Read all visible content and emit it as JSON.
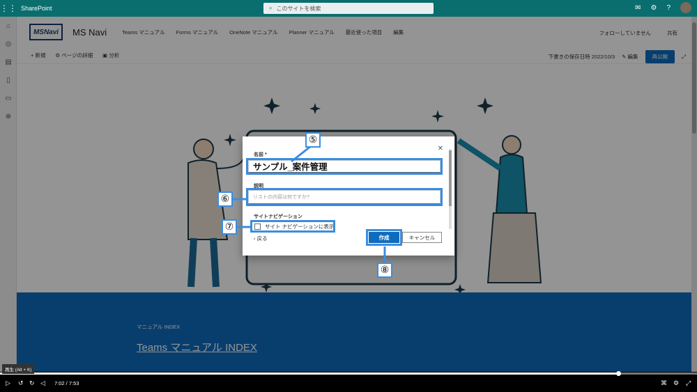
{
  "suite": {
    "app_name": "SharePoint",
    "search_placeholder": "このサイトを検索"
  },
  "site": {
    "logo_text": "MSNavi",
    "name": "MS Navi",
    "nav": [
      "Teams マニュアル",
      "Forms マニュアル",
      "OneNote マニュアル",
      "Planner マニュアル",
      "最近使った項目",
      "編集"
    ],
    "follow": "フォローしていません",
    "share": "共有"
  },
  "commandbar": {
    "new": "新規",
    "page_details": "ページの詳細",
    "analytics": "分析",
    "saved_draft": "下書きの保存日時 2022/10/3",
    "edit": "編集",
    "republish": "再公開"
  },
  "blue_section": {
    "label": "マニュアル INDEX",
    "link": "Teams マニュアル INDEX"
  },
  "dialog": {
    "name_label": "名前 *",
    "name_value": "サンプル_案件管理",
    "description_label": "説明",
    "description_placeholder": "リストの内容は何ですか?",
    "site_nav_label": "サイトナビゲーション",
    "site_nav_checkbox": "サイト ナビゲーションに表示",
    "back": "戻る",
    "create": "作成",
    "cancel": "キャンセル",
    "close_icon": "close-icon"
  },
  "callouts": [
    "⑤",
    "⑥",
    "⑦",
    "⑧"
  ],
  "player": {
    "tooltip": "再生 (Alt + K)",
    "time": "7:02 / 7:53",
    "progress": 0.887
  }
}
